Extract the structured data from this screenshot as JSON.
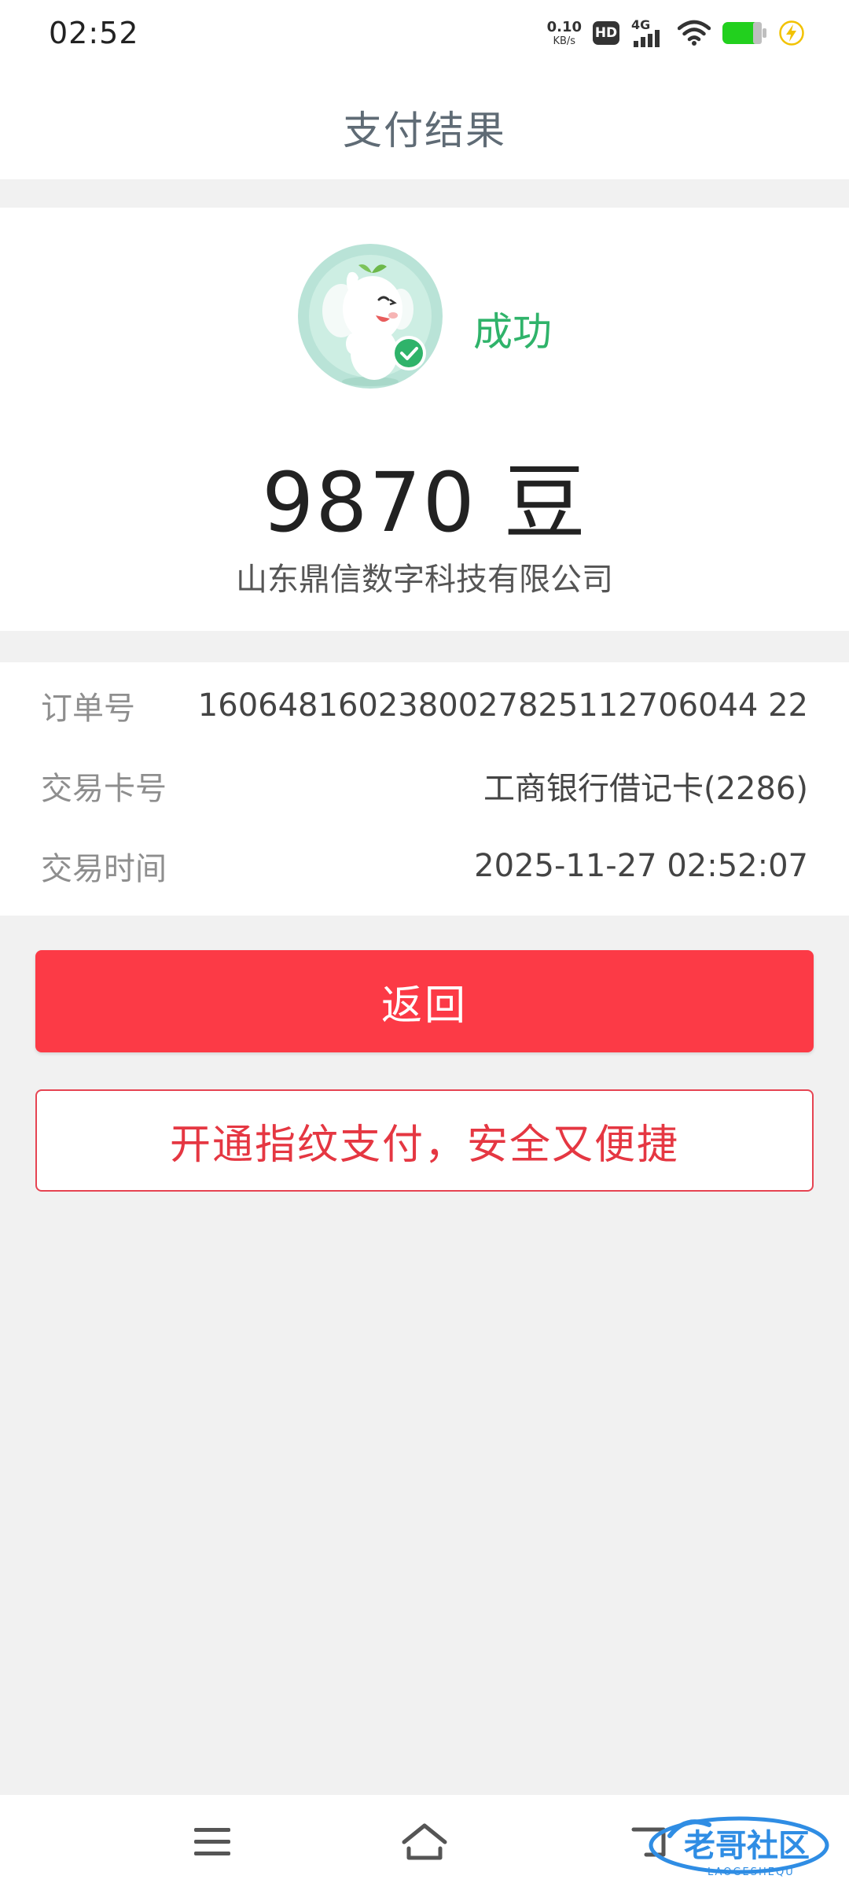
{
  "status_bar": {
    "time": "02:52",
    "net_speed_value": "0.10",
    "net_speed_unit": "KB/s",
    "hd_label": "HD",
    "network_label": "4G",
    "battery_color": "#22d01e",
    "charging_color": "#f2c200"
  },
  "header": {
    "title": "支付结果"
  },
  "result": {
    "status": "成功",
    "amount": "9870 豆",
    "merchant": "山东鼎信数字科技有限公司"
  },
  "details": [
    {
      "label": "订单号",
      "value": "1606481602380027825112706044 22"
    },
    {
      "label": "交易卡号",
      "value": "工商银行借记卡(2286)"
    },
    {
      "label": "交易时间",
      "value": "2025-11-27 02:52:07"
    }
  ],
  "buttons": {
    "return_label": "返回",
    "fingerprint_label": "开通指纹支付，安全又便捷"
  },
  "nav": {
    "menu_icon": "menu-icon",
    "home_icon": "home-icon",
    "back_icon": "back-icon"
  },
  "watermark": {
    "text": "老哥社区",
    "subtext": "LAOGESHEQU"
  },
  "colors": {
    "accent_red": "#fc3a46",
    "success_green": "#2fb36a"
  }
}
